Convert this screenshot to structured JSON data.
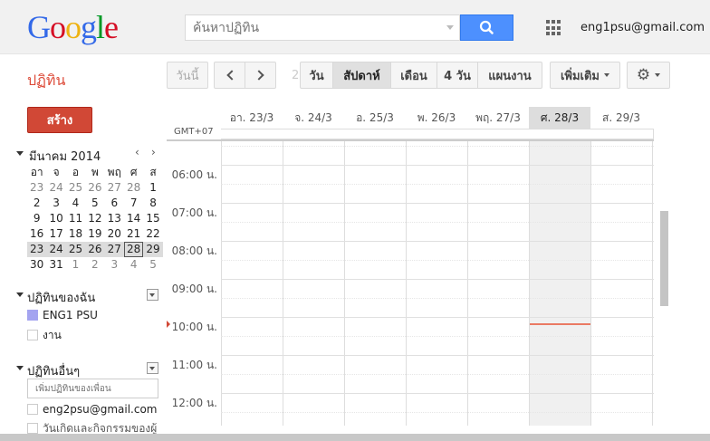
{
  "header": {
    "logo_letters": [
      {
        "ch": "G",
        "color": "#3369e8"
      },
      {
        "ch": "o",
        "color": "#d50f25"
      },
      {
        "ch": "o",
        "color": "#eeb211"
      },
      {
        "ch": "g",
        "color": "#3369e8"
      },
      {
        "ch": "l",
        "color": "#009925"
      },
      {
        "ch": "e",
        "color": "#d50f25"
      }
    ],
    "search_placeholder": "ค้นหาปฏิทิน",
    "search_icon": "search-icon",
    "apps_icon": "apps-grid-icon",
    "user_email": "eng1psu@gmail.com"
  },
  "toolbar": {
    "app_title": "ปฏิทิน",
    "today": "วันนี้",
    "faint_text": "2",
    "views": {
      "day": "วัน",
      "week": "สัปดาห์",
      "month": "เดือน",
      "four_days": "4 วัน",
      "agenda": "แผนงาน"
    },
    "more": "เพิ่มเติม",
    "settings_icon": "gear-icon",
    "gear_glyph": "⚙"
  },
  "sidebar": {
    "create": "สร้าง",
    "mini_cal": {
      "title": "มีนาคม 2014",
      "prev": "‹",
      "next": "›",
      "dow": [
        "อา",
        "จ",
        "อ",
        "พ",
        "พฤ",
        "ศ",
        "ส"
      ],
      "weeks": [
        [
          "23",
          "24",
          "25",
          "26",
          "27",
          "28",
          "1"
        ],
        [
          "2",
          "3",
          "4",
          "5",
          "6",
          "7",
          "8"
        ],
        [
          "9",
          "10",
          "11",
          "12",
          "13",
          "14",
          "15"
        ],
        [
          "16",
          "17",
          "18",
          "19",
          "20",
          "21",
          "22"
        ],
        [
          "23",
          "24",
          "25",
          "26",
          "27",
          "28",
          "29"
        ],
        [
          "30",
          "31",
          "1",
          "2",
          "3",
          "4",
          "5"
        ]
      ]
    },
    "my_calendars": {
      "title": "ปฏิทินของฉัน",
      "items": [
        {
          "label": "ENG1 PSU",
          "color": "#a4a4f0"
        },
        {
          "label": "งาน",
          "color": ""
        }
      ]
    },
    "other_calendars": {
      "title": "ปฏิทินอื่นๆ",
      "add_placeholder": "เพิ่มปฏิทินของเพื่อน",
      "items": [
        {
          "label": "eng2psu@gmail.com"
        },
        {
          "label": "วันเกิดและกิจกรรมของผู้"
        }
      ]
    }
  },
  "calendar": {
    "timezone": "GMT+07",
    "days": [
      "อา. 23/3",
      "จ. 24/3",
      "อ. 25/3",
      "พ. 26/3",
      "พฤ. 27/3",
      "ศ. 28/3",
      "ส. 29/3"
    ],
    "today_index": 5,
    "hours": [
      "06:00 น.",
      "07:00 น.",
      "08:00 น.",
      "09:00 น.",
      "10:00 น.",
      "11:00 น.",
      "12:00 น."
    ]
  }
}
